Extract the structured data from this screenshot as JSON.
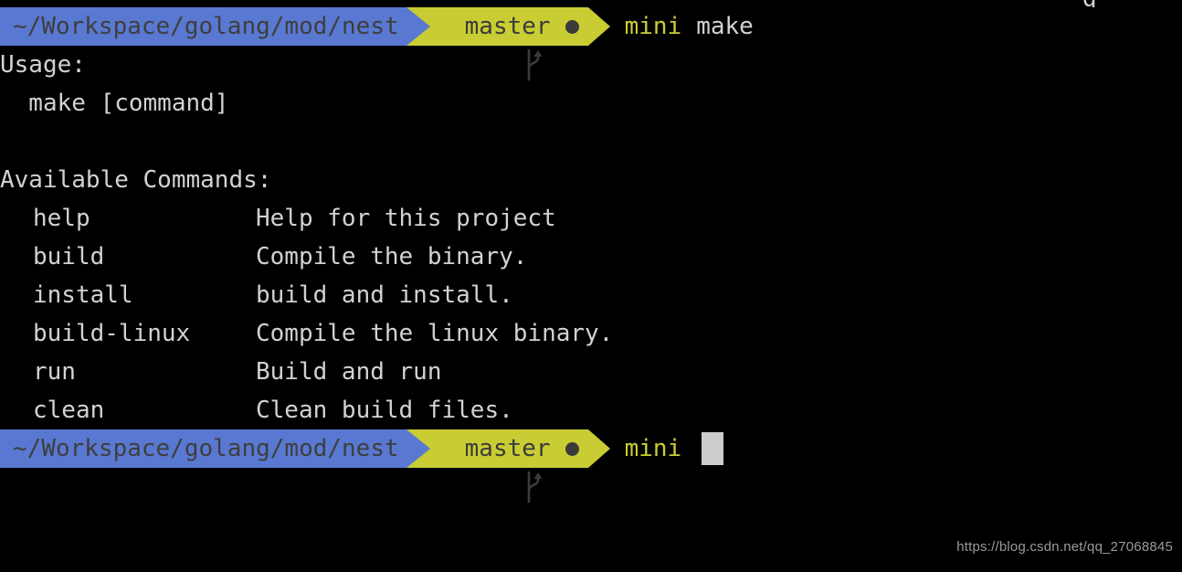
{
  "terminal": {
    "background_color": "#000000",
    "foreground_color": "#d2d2d2",
    "clipped_top_glyph": "g"
  },
  "prompt_top": {
    "path": "~/Workspace/golang/mod/nest",
    "branch_icon": "git-branch-icon",
    "branch": "master",
    "dirty_indicator": "●",
    "user": "mini",
    "command": "make",
    "path_bg": "#5978d1",
    "branch_bg": "#c9cd33",
    "user_color": "#c9cd33",
    "command_color": "#d2d2d2"
  },
  "output": {
    "usage_heading": "Usage:",
    "usage_line": "  make [command]",
    "commands_heading": "Available Commands:",
    "commands": [
      {
        "name": "help",
        "description": "Help for this project"
      },
      {
        "name": "build",
        "description": "Compile the binary."
      },
      {
        "name": "install",
        "description": "build and install."
      },
      {
        "name": "build-linux",
        "description": "Compile the linux binary."
      },
      {
        "name": "run",
        "description": "Build and run"
      },
      {
        "name": "clean",
        "description": "Clean build files."
      }
    ]
  },
  "prompt_bottom": {
    "path": "~/Workspace/golang/mod/nest",
    "branch_icon": "git-branch-icon",
    "branch": "master",
    "dirty_indicator": "●",
    "user": "mini",
    "cursor": "block-cursor"
  },
  "watermark": {
    "text": "https://blog.csdn.net/qq_27068845"
  }
}
